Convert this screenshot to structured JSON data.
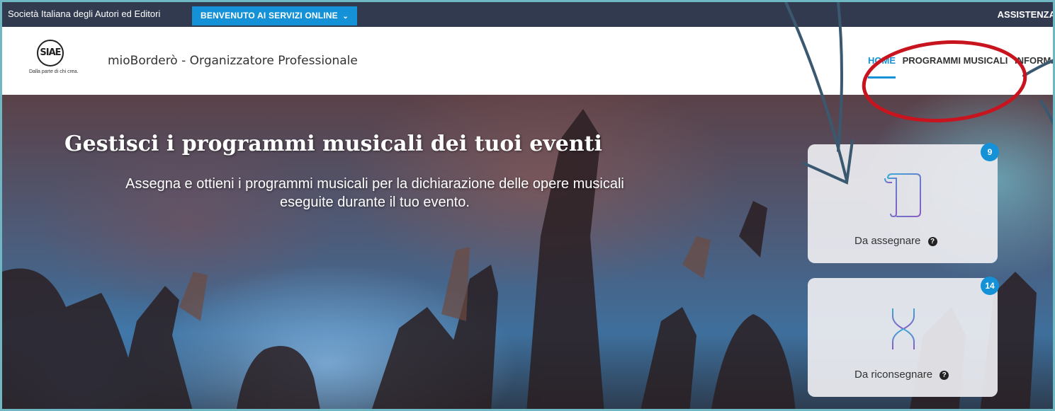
{
  "topbar": {
    "organization": "Società Italiana degli Autori ed Editori",
    "services_menu": "BENVENUTO AI SERVIZI ONLINE",
    "services_chevron": "⌄",
    "help": "ASSISTENZA"
  },
  "header": {
    "logo_text": "SIAE",
    "logo_tagline": "Dalla parte di chi crea.",
    "app_title": "mioBorderò - Organizzatore Professionale",
    "nav": {
      "home": "HOME",
      "music_programs": "PROGRAMMI MUSICALI",
      "info": "INFORMATIVE"
    }
  },
  "hero": {
    "title": "Gestisci i programmi musicali dei tuoi eventi",
    "subtitle_line1": "Assegna e ottieni i programmi musicali per la dichiarazione delle opere musicali",
    "subtitle_line2": "eseguite durante il tuo evento."
  },
  "cards": [
    {
      "label": "Da assegnare",
      "count": "9",
      "icon": "scroll-icon",
      "help_glyph": "?"
    },
    {
      "label": "Da riconsegnare",
      "count": "14",
      "icon": "hourglass-icon",
      "help_glyph": "?"
    }
  ],
  "colors": {
    "topbar_bg": "#323a4f",
    "accent_blue": "#1592d7",
    "annotation_red": "#c8141e",
    "annotation_arrow": "#3a5870",
    "frame_border": "#6fb7c3"
  }
}
